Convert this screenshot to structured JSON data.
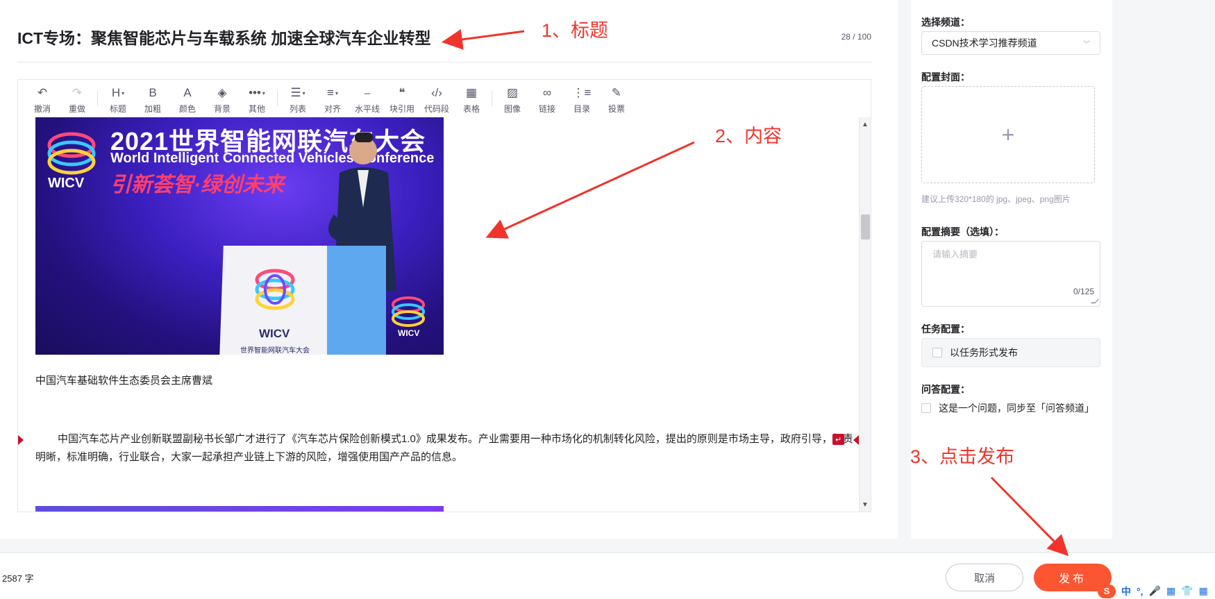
{
  "title": {
    "text": "ICT专场：聚焦智能芯片与车载系统 加速全球汽车企业转型",
    "count": "28 / 100"
  },
  "toolbar": [
    {
      "name": "undo",
      "icon": "↶",
      "label": "撤消",
      "disabled": false
    },
    {
      "name": "redo",
      "icon": "↷",
      "label": "重做",
      "disabled": true
    },
    {
      "name": "sep"
    },
    {
      "name": "heading",
      "icon": "H",
      "label": "标题",
      "caret": true
    },
    {
      "name": "bold",
      "icon": "B",
      "label": "加粗"
    },
    {
      "name": "color",
      "icon": "A",
      "label": "颜色"
    },
    {
      "name": "background",
      "icon": "◈",
      "label": "背景"
    },
    {
      "name": "more",
      "icon": "•••",
      "label": "其他",
      "caret": true
    },
    {
      "name": "sep"
    },
    {
      "name": "list",
      "icon": "☰",
      "label": "列表",
      "caret": true
    },
    {
      "name": "align",
      "icon": "≡",
      "label": "对齐",
      "caret": true
    },
    {
      "name": "hr",
      "icon": "⎯",
      "label": "水平线"
    },
    {
      "name": "blockquote",
      "icon": "❝",
      "label": "块引用"
    },
    {
      "name": "code",
      "icon": "‹/›",
      "label": "代码段"
    },
    {
      "name": "table",
      "icon": "▦",
      "label": "表格"
    },
    {
      "name": "sep"
    },
    {
      "name": "image",
      "icon": "▨",
      "label": "图像"
    },
    {
      "name": "link",
      "icon": "∞",
      "label": "链接"
    },
    {
      "name": "toc",
      "icon": "⋮≡",
      "label": "目录"
    },
    {
      "name": "vote",
      "icon": "✎",
      "label": "投票"
    }
  ],
  "photo": {
    "headline": "2021世界智能网联汽车大会",
    "subline": "World Intelligent Connected Vehicles Conference",
    "slogan": "引新荟智·绿创未来",
    "logo_text": "WICV",
    "podium_text": "WICV",
    "podium_caption": "世界智能网联汽车大会"
  },
  "content": {
    "caption": "中国汽车基础软件生态委员会主席曹斌",
    "paragraph": "中国汽车芯片产业创新联盟副秘书长邹广才进行了《汽车芯片保险创新模式1.0》成果发布。产业需要用一种市场化的机制转化风险，提出的原则是市场主导，政府引导，权责明晰，标准明确，行业联合，大家一起承担产业链上下游的风险，增强使用国产产品的信息。",
    "return_mark": "↵"
  },
  "sidebar": {
    "channel_label": "选择频道：",
    "channel_value": "CSDN技术学习推荐频道",
    "cover_label": "配置封面：",
    "cover_plus": "+",
    "cover_hint": "建议上传320*180的 jpg、jpeg、png图片",
    "summary_label": "配置摘要（选填）：",
    "summary_placeholder": "请输入摘要",
    "summary_count": "0/125",
    "task_label": "任务配置：",
    "task_option": "以任务形式发布",
    "qa_label": "问答配置：",
    "qa_option": "这是一个问题，同步至「问答频道」"
  },
  "footer": {
    "word_count": "2587 字",
    "cancel": "取消",
    "publish": "发布"
  },
  "ime": {
    "logo": "S",
    "items": [
      "中",
      "°,",
      "🎤",
      "▦",
      "👕",
      "▦"
    ]
  },
  "annotations": {
    "title": "1、标题",
    "content": "2、内容",
    "publish": "3、点击发布"
  },
  "colors": {
    "accent": "#fc5531",
    "annotation": "#f0342b"
  }
}
